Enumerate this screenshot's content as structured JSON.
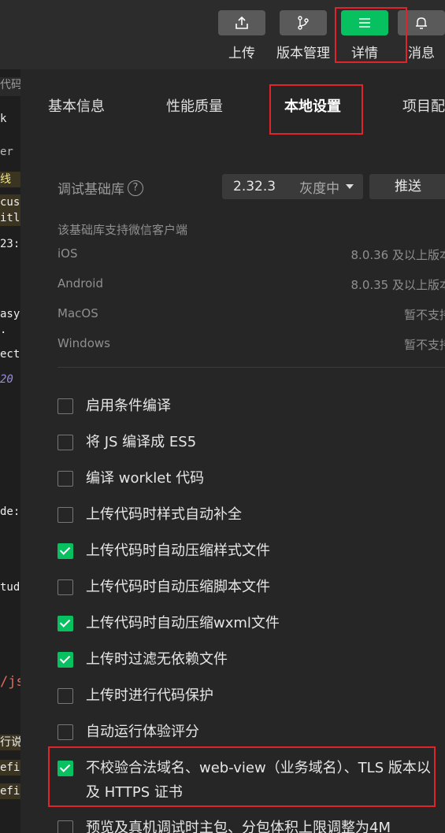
{
  "toolbar": {
    "upload_label": "上传",
    "version_label": "版本管理",
    "details_label": "详情",
    "messages_label": "消息",
    "details_color": "#07c160"
  },
  "editor_fragments": [
    "代码",
    "k",
    "er",
    "线",
    "cus",
    "itl",
    "23:",
    "asy",
    ".",
    "ect",
    "20",
    "de:",
    "tud",
    "/js",
    "行说",
    "efi",
    "efi"
  ],
  "tabs": [
    "基本信息",
    "性能质量",
    "本地设置",
    "项目配"
  ],
  "active_tab": "本地设置",
  "debug_lib": {
    "label": "调试基础库",
    "help_icon": "?",
    "version": "2.32.3",
    "status": "灰度中",
    "push_label": "推送"
  },
  "support": {
    "title": "该基础库支持微信客户端",
    "platforms": [
      {
        "name": "iOS",
        "version": "8.0.36 及以上版本"
      },
      {
        "name": "Android",
        "version": "8.0.35 及以上版本"
      },
      {
        "name": "MacOS",
        "version": "暂不支持"
      },
      {
        "name": "Windows",
        "version": "暂不支持"
      }
    ]
  },
  "options": [
    {
      "label": "启用条件编译",
      "checked": false
    },
    {
      "label": "将 JS 编译成 ES5",
      "checked": false
    },
    {
      "label": "编译 worklet 代码",
      "checked": false
    },
    {
      "label": "上传代码时样式自动补全",
      "checked": false
    },
    {
      "label": "上传代码时自动压缩样式文件",
      "checked": true
    },
    {
      "label": "上传代码时自动压缩脚本文件",
      "checked": false
    },
    {
      "label": "上传代码时自动压缩wxml文件",
      "checked": true
    },
    {
      "label": "上传时过滤无依赖文件",
      "checked": true
    },
    {
      "label": "上传时进行代码保护",
      "checked": false
    },
    {
      "label": "自动运行体验评分",
      "checked": false
    },
    {
      "label": "不校验合法域名、web-view（业务域名）、TLS 版本以及 HTTPS 证书",
      "checked": true
    },
    {
      "label": "预览及真机调试时主包、分包体积上限调整为4M",
      "checked": false
    }
  ]
}
